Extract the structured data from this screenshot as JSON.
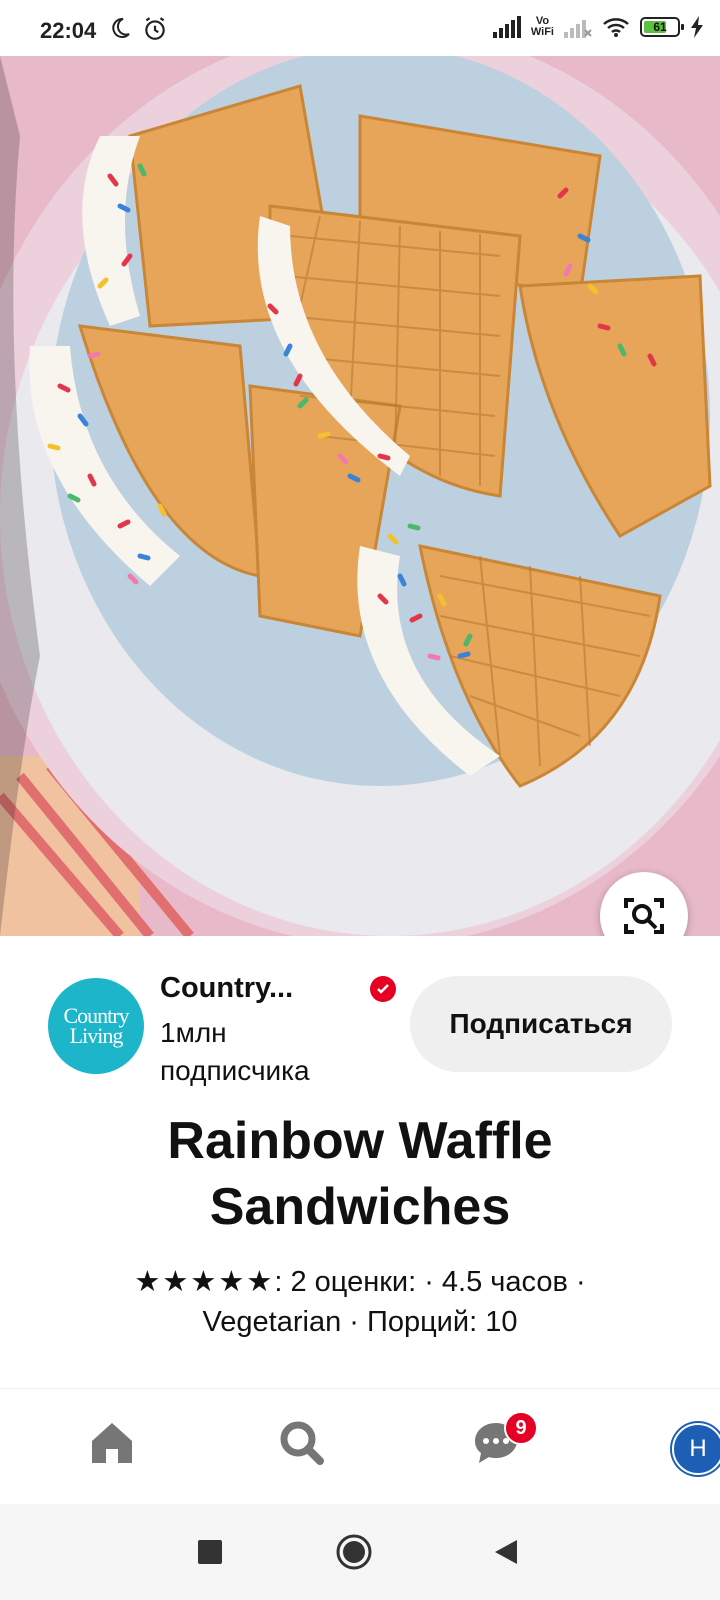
{
  "status_bar": {
    "time": "22:04",
    "vowifi_top": "Vo",
    "vowifi_bottom": "WiFi",
    "battery_level": "61"
  },
  "creator": {
    "name": "Country...",
    "followers": "1млн подписчика",
    "avatar_line1": "Country",
    "avatar_line2": "Living",
    "follow_label": "Подписаться"
  },
  "pin": {
    "title": "Rainbow Waffle Sandwiches",
    "stars": "★★★★★",
    "meta_line1": ": 2 оценки: · 4.5 часов ·",
    "meta_line2": "Vegetarian · Порций: 10"
  },
  "bottom_nav": {
    "messages_badge": "9",
    "profile_initial": "Н"
  },
  "colors": {
    "accent": "#e60023",
    "avatar_bg": "#1db5c9",
    "profile_bg": "#1c5fb5"
  }
}
